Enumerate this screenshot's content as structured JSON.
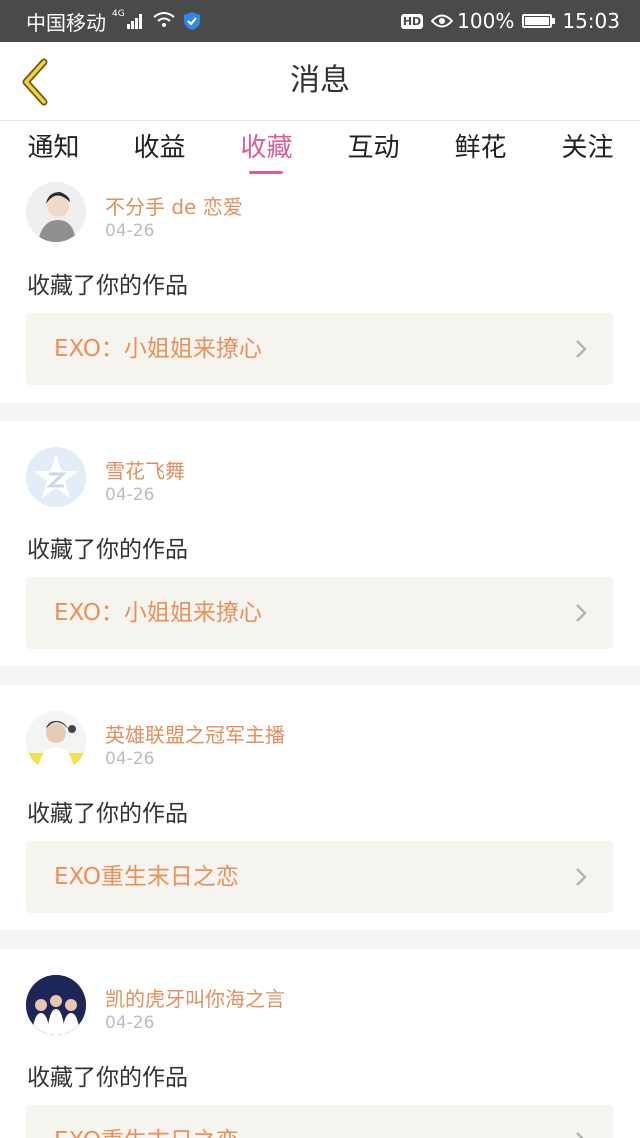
{
  "status_bar": {
    "carrier": "中国移动",
    "network": "4G",
    "hd": "HD",
    "battery": "100%",
    "time": "15:03"
  },
  "header": {
    "title": "消息"
  },
  "tabs": [
    {
      "label": "通知",
      "active": false
    },
    {
      "label": "收益",
      "active": false
    },
    {
      "label": "收藏",
      "active": true
    },
    {
      "label": "互动",
      "active": false
    },
    {
      "label": "鲜花",
      "active": false
    },
    {
      "label": "关注",
      "active": false
    }
  ],
  "messages": [
    {
      "user": "不分手 de 恋爱",
      "date": "04-26",
      "action": "收藏了你的作品",
      "work": "EXO：小姐姐来撩心"
    },
    {
      "user": "雪花飞舞",
      "date": "04-26",
      "action": "收藏了你的作品",
      "work": "EXO：小姐姐来撩心"
    },
    {
      "user": "英雄联盟之冠军主播",
      "date": "04-26",
      "action": "收藏了你的作品",
      "work": "EXO重生末日之恋"
    },
    {
      "user": "凯的虎牙叫你海之言",
      "date": "04-26",
      "action": "收藏了你的作品",
      "work": "EXO重生末日之恋"
    }
  ],
  "colors": {
    "accent": "#d7609a",
    "username": "#e0915f",
    "work_title": "#e8915c",
    "work_bg": "#f5f4ee",
    "status_bar": "#4a4a4a"
  }
}
